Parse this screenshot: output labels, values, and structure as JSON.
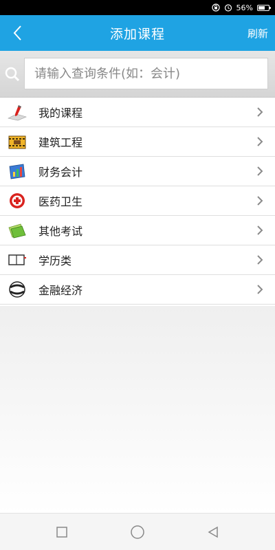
{
  "status_bar": {
    "battery_percent": "56%",
    "battery_level": 0.56
  },
  "header": {
    "title": "添加课程",
    "right_action": "刷新"
  },
  "search": {
    "placeholder": "请输入查询条件(如：会计)"
  },
  "list": {
    "items": [
      {
        "label": "我的课程",
        "icon": "pencil-ruler-icon"
      },
      {
        "label": "建筑工程",
        "icon": "construction-icon"
      },
      {
        "label": "财务会计",
        "icon": "finance-chart-icon"
      },
      {
        "label": "医药卫生",
        "icon": "medical-cross-icon"
      },
      {
        "label": "其他考试",
        "icon": "folders-icon"
      },
      {
        "label": "学历类",
        "icon": "book-icon"
      },
      {
        "label": "金融经济",
        "icon": "globe-swoosh-icon"
      }
    ]
  },
  "colors": {
    "header_bg": "#1fa3e3",
    "accent_red": "#d9231f"
  }
}
